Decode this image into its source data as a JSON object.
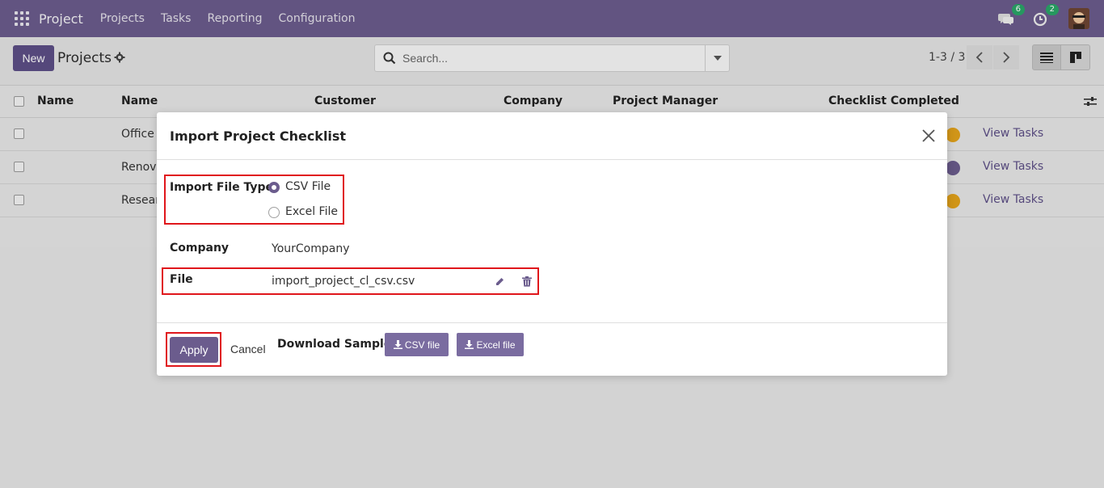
{
  "navbar": {
    "brand": "Project",
    "menu": [
      "Projects",
      "Tasks",
      "Reporting",
      "Configuration"
    ],
    "messages_count": "6",
    "activities_count": "2"
  },
  "control": {
    "new_label": "New",
    "breadcrumb": "Projects",
    "search_placeholder": "Search...",
    "pager": "1-3 / 3"
  },
  "list": {
    "headers": [
      "Name",
      "Name",
      "Customer",
      "Company",
      "Project Manager",
      "Checklist Completed"
    ],
    "rows": [
      {
        "name": "Office",
        "status_color": "#e2a21b",
        "action": "View Tasks"
      },
      {
        "name": "Renova",
        "status_color": "#6b5c8d",
        "action": "View Tasks"
      },
      {
        "name": "Resear",
        "status_color": "#e2a21b",
        "action": "View Tasks"
      }
    ]
  },
  "dialog": {
    "title": "Import Project Checklist",
    "import_type_label": "Import File Type",
    "options": [
      {
        "label": "CSV File",
        "selected": true
      },
      {
        "label": "Excel File",
        "selected": false
      }
    ],
    "company_label": "Company",
    "company_value": "YourCompany",
    "file_label": "File",
    "file_value": "import_project_cl_csv.csv",
    "apply_label": "Apply",
    "cancel_label": "Cancel",
    "download_label": "Download Sample:",
    "csv_sample_label": "CSV file",
    "excel_sample_label": "Excel file"
  },
  "colors": {
    "brand": "#6b5c8d",
    "highlight": "#e0161b"
  }
}
